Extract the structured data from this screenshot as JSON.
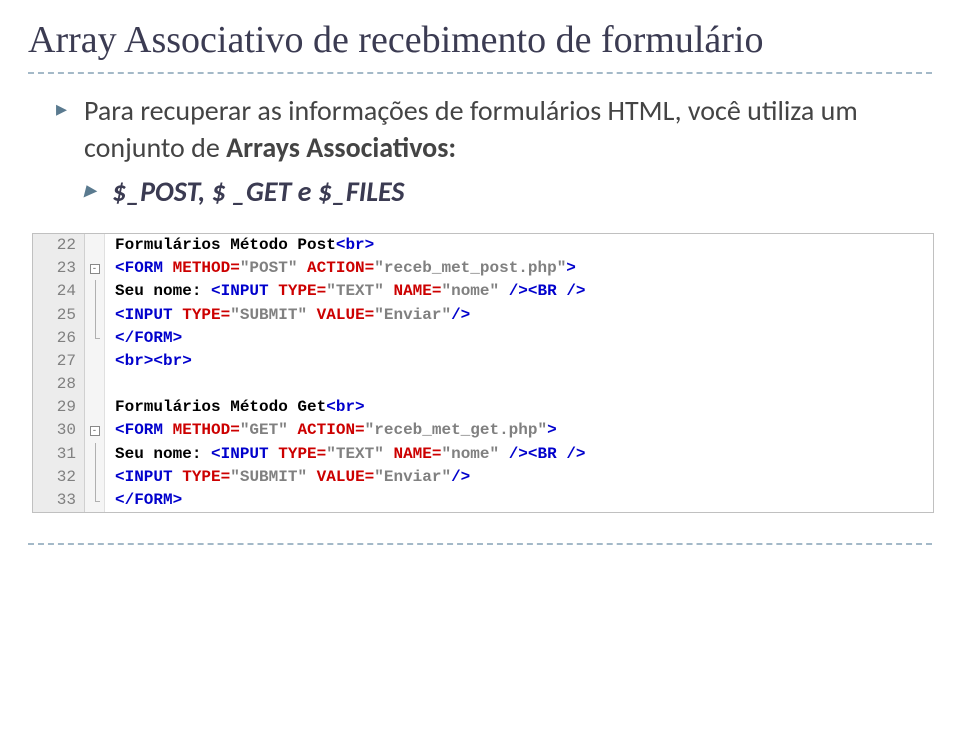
{
  "title": "Array Associativo de recebimento de formulário",
  "bullets": [
    {
      "pre": "Para recuperar as informações de formulários HTML, você utiliza um conjunto de ",
      "bold": "Arrays Associativos:"
    },
    {
      "sub": "$_POST, $ _GET e $_FILES"
    }
  ],
  "code_lines": [
    {
      "num": "22",
      "fold": "none",
      "spans": [
        {
          "t": "Formulários Método Post",
          "c": "black"
        },
        {
          "t": "<br>",
          "c": "blue"
        }
      ]
    },
    {
      "num": "23",
      "fold": "open",
      "spans": [
        {
          "t": "<FORM ",
          "c": "blue"
        },
        {
          "t": "METHOD=",
          "c": "red"
        },
        {
          "t": "\"POST\" ",
          "c": "gray"
        },
        {
          "t": "ACTION=",
          "c": "red"
        },
        {
          "t": "\"receb_met_post.php\"",
          "c": "gray"
        },
        {
          "t": ">",
          "c": "blue"
        }
      ]
    },
    {
      "num": "24",
      "fold": "line",
      "spans": [
        {
          "t": "Seu nome: ",
          "c": "black"
        },
        {
          "t": "<INPUT ",
          "c": "blue"
        },
        {
          "t": "TYPE=",
          "c": "red"
        },
        {
          "t": "\"TEXT\" ",
          "c": "gray"
        },
        {
          "t": "NAME=",
          "c": "red"
        },
        {
          "t": "\"nome\" ",
          "c": "gray"
        },
        {
          "t": "/><BR />",
          "c": "blue"
        }
      ]
    },
    {
      "num": "25",
      "fold": "line",
      "spans": [
        {
          "t": "<INPUT ",
          "c": "blue"
        },
        {
          "t": "TYPE=",
          "c": "red"
        },
        {
          "t": "\"SUBMIT\" ",
          "c": "gray"
        },
        {
          "t": "VALUE=",
          "c": "red"
        },
        {
          "t": "\"Enviar\"",
          "c": "gray"
        },
        {
          "t": "/>",
          "c": "blue"
        }
      ]
    },
    {
      "num": "26",
      "fold": "end",
      "spans": [
        {
          "t": "</FORM>",
          "c": "blue"
        }
      ]
    },
    {
      "num": "27",
      "fold": "none",
      "spans": [
        {
          "t": "<br><br>",
          "c": "blue"
        }
      ]
    },
    {
      "num": "28",
      "fold": "none",
      "spans": []
    },
    {
      "num": "29",
      "fold": "none",
      "spans": [
        {
          "t": "Formulários Método Get",
          "c": "black"
        },
        {
          "t": "<br>",
          "c": "blue"
        }
      ]
    },
    {
      "num": "30",
      "fold": "open",
      "spans": [
        {
          "t": "<FORM ",
          "c": "blue"
        },
        {
          "t": "METHOD=",
          "c": "red"
        },
        {
          "t": "\"GET\" ",
          "c": "gray"
        },
        {
          "t": "ACTION=",
          "c": "red"
        },
        {
          "t": "\"receb_met_get.php\"",
          "c": "gray"
        },
        {
          "t": ">",
          "c": "blue"
        }
      ]
    },
    {
      "num": "31",
      "fold": "line",
      "spans": [
        {
          "t": "Seu nome: ",
          "c": "black"
        },
        {
          "t": "<INPUT ",
          "c": "blue"
        },
        {
          "t": "TYPE=",
          "c": "red"
        },
        {
          "t": "\"TEXT\" ",
          "c": "gray"
        },
        {
          "t": "NAME=",
          "c": "red"
        },
        {
          "t": "\"nome\" ",
          "c": "gray"
        },
        {
          "t": "/><BR />",
          "c": "blue"
        }
      ]
    },
    {
      "num": "32",
      "fold": "line",
      "spans": [
        {
          "t": "<INPUT ",
          "c": "blue"
        },
        {
          "t": "TYPE=",
          "c": "red"
        },
        {
          "t": "\"SUBMIT\" ",
          "c": "gray"
        },
        {
          "t": "VALUE=",
          "c": "red"
        },
        {
          "t": "\"Enviar\"",
          "c": "gray"
        },
        {
          "t": "/>",
          "c": "blue"
        }
      ]
    },
    {
      "num": "33",
      "fold": "end",
      "spans": [
        {
          "t": "</FORM>",
          "c": "blue"
        }
      ]
    }
  ]
}
